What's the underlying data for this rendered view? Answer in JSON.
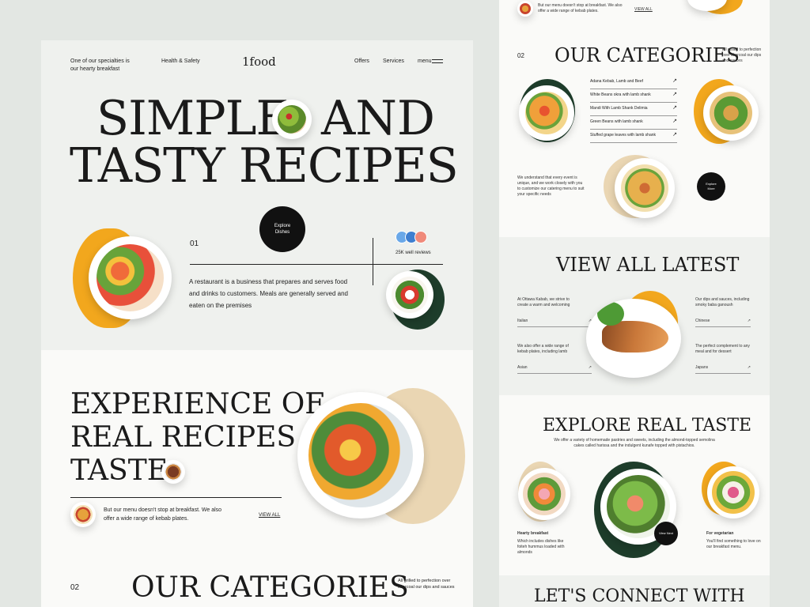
{
  "nav": {
    "specialty": "One of our specialties is our hearty breakfast",
    "health": "Health & Safety",
    "logo": "1food",
    "offers": "Offers",
    "services": "Services",
    "menu": "menu"
  },
  "hero": {
    "title_line1a": "SIMPLE",
    "title_line1b": "AND",
    "title_line2": "TASTY RECIPES",
    "explore_btn": "Explore Dishes",
    "number": "01",
    "reviews": "25K well reviews",
    "description": "A restaurant is a business that prepares and serves food and drinks to customers. Meals are generally served and eaten on the premises"
  },
  "experience": {
    "title_line1": "EXPERIENCE OF",
    "title_line2": "REAL RECIPES",
    "title_line3": "TASTE",
    "text": "But our menu doesn't stop at breakfast. We also offer a wide range of kebab plates.",
    "view_all": "VIEW ALL"
  },
  "categories_left": {
    "number": "02",
    "title": "OUR CATEGORIES",
    "text": "All grilled to perfection over charcoal our dips and sauces"
  },
  "right": {
    "top_text": "But our menu doesn't stop at breakfast. We also offer a wide range of kebab plates.",
    "top_view_all": "VIEW ALL",
    "cat_number": "02",
    "cat_title": "OUR CATEGORIES",
    "cat_side_text": "All grilled to perfection over charcoal our dips and sauces",
    "cat_items": [
      "Adana Kebab, Lamb and Beef",
      "White Beans okra with lamb shank",
      "Mandi With Lamb Shank Delimia",
      "Green Beans with lamb shank",
      "Stuffed grape leaves with lamb shank"
    ],
    "catering_text": "We understand that every event is unique, and we work closely with you to customize our catering menu to suit your specific needs",
    "explore_more": "Explore More",
    "latest_title": "VIEW ALL LATEST",
    "latest_left_text1": "At Ottawa Kabab, we strive to create a warm and welcoming",
    "latest_left_link1": "Italian",
    "latest_left_text2": "We also offer a wide range of kebab plates, including lamb",
    "latest_left_link2": "Asian",
    "latest_right_text1": "Our dips and sauces, including smoky baba ganoush",
    "latest_right_link1": "Chinese",
    "latest_right_text2": "The perfect complement to any meal and for dessert",
    "latest_right_link2": "Japans",
    "taste_title": "EXPLORE REAL TASTE",
    "taste_text": "We offer a variety of homemade pastries and sweets, including the almond-topped semolina cakes called harissa and the indulgent kunafe topped with pistachios.",
    "hearty_title": "Hearty breakfast",
    "hearty_text": "Which includes dishes like foiteh hummus loaded with almonds",
    "veg_title": "For vegetarian",
    "veg_text": "You'll find something to love on our breakfast menu.",
    "view_next": "View Next",
    "connect_title": "LET'S CONNECT WITH US"
  },
  "colors": {
    "accent_orange": "#f2a71d",
    "accent_green": "#1e3d2b",
    "tan": "#ead6b3",
    "bg": "#e3e7e3"
  }
}
